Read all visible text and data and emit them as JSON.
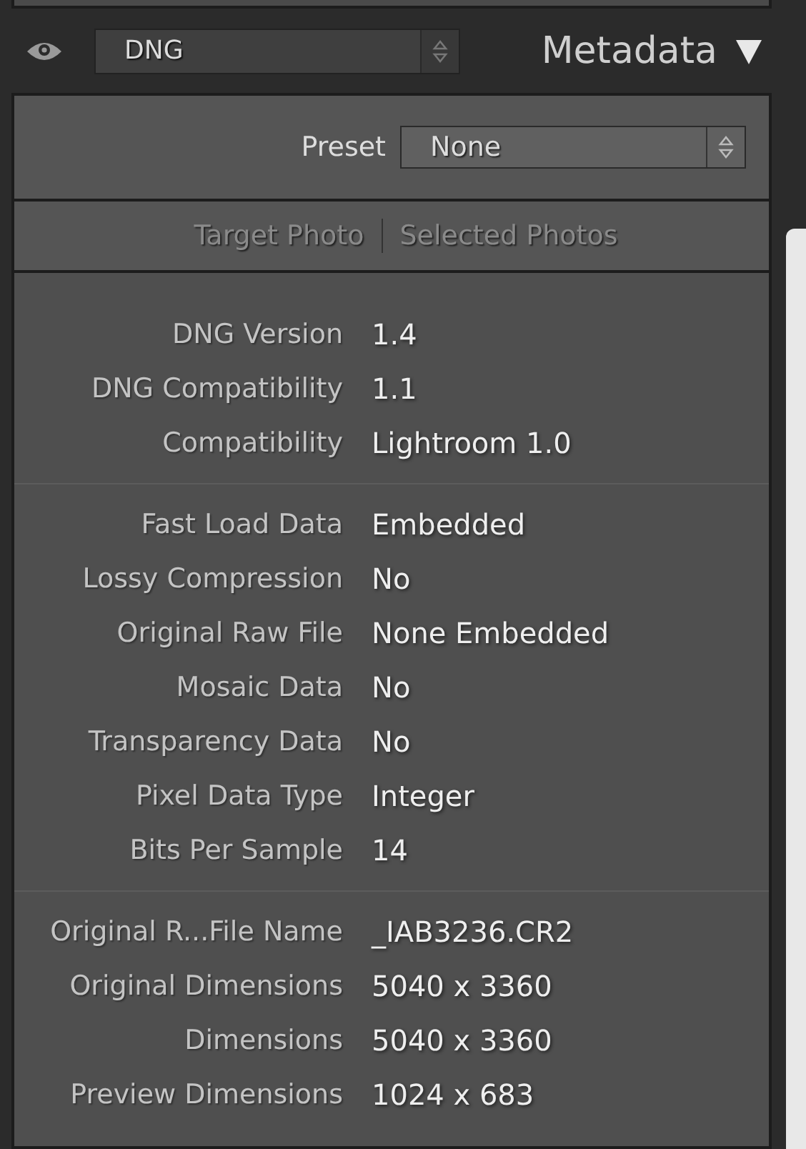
{
  "header": {
    "format_select": {
      "value": "DNG"
    },
    "title": "Metadata"
  },
  "preset": {
    "label": "Preset",
    "value": "None"
  },
  "tabs": [
    {
      "label": "Target Photo",
      "disabled": true
    },
    {
      "label": "Selected Photos",
      "disabled": true
    }
  ],
  "groups": [
    {
      "rows": [
        {
          "label": "DNG Version",
          "value": "1.4"
        },
        {
          "label": "DNG Compatibility",
          "value": "1.1"
        },
        {
          "label": "Compatibility",
          "value": "Lightroom 1.0"
        }
      ]
    },
    {
      "rows": [
        {
          "label": "Fast Load Data",
          "value": "Embedded"
        },
        {
          "label": "Lossy Compression",
          "value": "No"
        },
        {
          "label": "Original Raw File",
          "value": "None Embedded"
        },
        {
          "label": "Mosaic Data",
          "value": "No"
        },
        {
          "label": "Transparency Data",
          "value": "No"
        },
        {
          "label": "Pixel Data Type",
          "value": "Integer"
        },
        {
          "label": "Bits Per Sample",
          "value": "14"
        }
      ]
    },
    {
      "rows": [
        {
          "label": "Original R...File Name",
          "value": "_IAB3236.CR2"
        },
        {
          "label": "Original Dimensions",
          "value": "5040 x 3360"
        },
        {
          "label": "Dimensions",
          "value": "5040 x 3360"
        },
        {
          "label": "Preview Dimensions",
          "value": "1024 x 683"
        }
      ]
    }
  ]
}
